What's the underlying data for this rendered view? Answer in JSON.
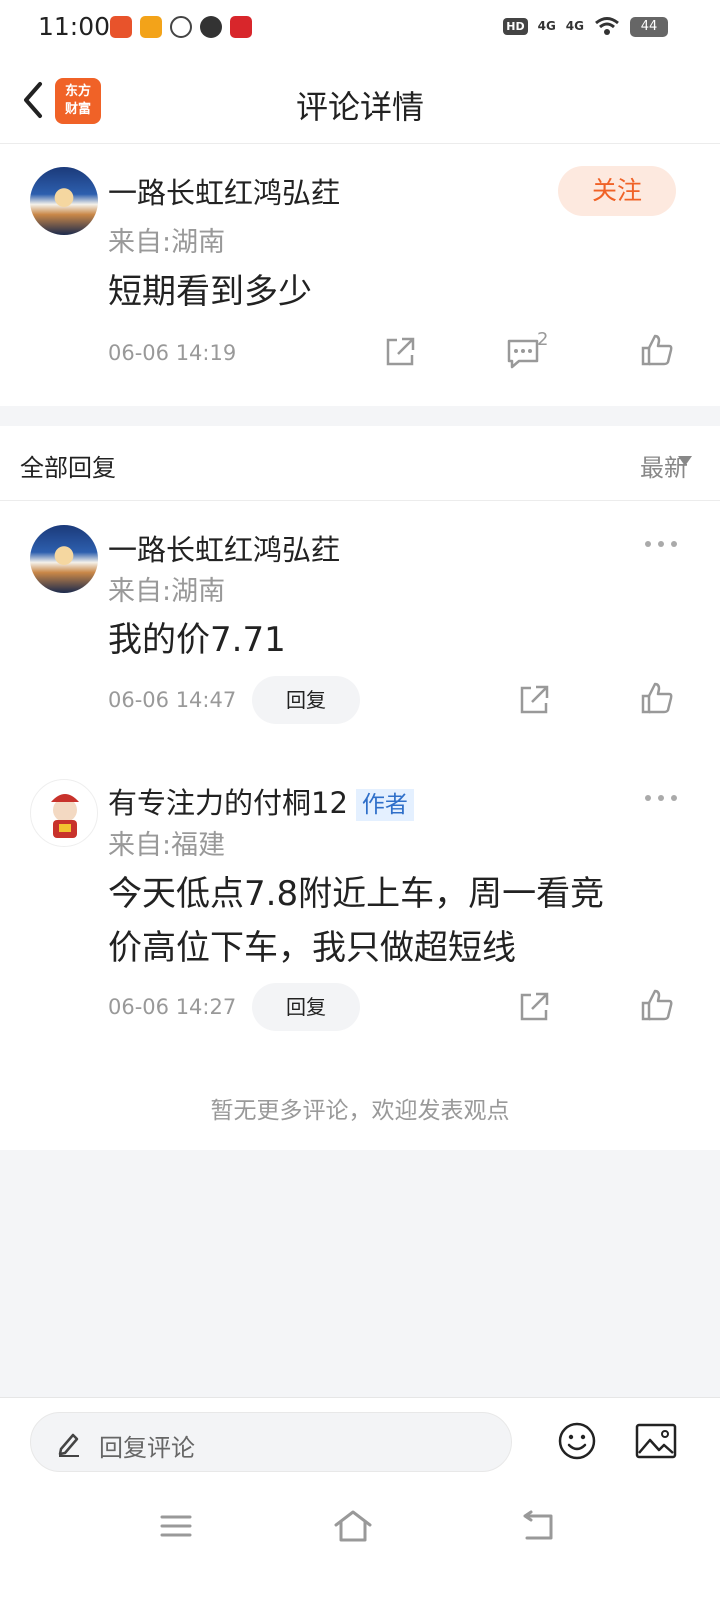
{
  "status_bar": {
    "time": "11:00",
    "network_1": "4G",
    "network_2": "4G",
    "hd_label": "HD",
    "battery": "44"
  },
  "nav": {
    "title": "评论详情",
    "logo_line1": "东方",
    "logo_line2": "财富"
  },
  "post": {
    "username": "一路长虹红鸿弘荭",
    "location": "来自:湖南",
    "text": "短期看到多少",
    "time": "06-06 14:19",
    "comment_count": "2",
    "follow_label": "关注"
  },
  "replies_header": {
    "title": "全部回复",
    "sort": "最新"
  },
  "replies": [
    {
      "username": "一路长虹红鸿弘荭",
      "location": "来自:湖南",
      "text": "我的价7.71",
      "time": "06-06 14:47",
      "reply_label": "回复"
    },
    {
      "username": "有专注力的付桐12",
      "badge": "作者",
      "location": "来自:福建",
      "text_line1": "今天低点7.8附近上车，周一看竞",
      "text_line2": "价高位下车，我只做超短线",
      "time": "06-06 14:27",
      "reply_label": "回复"
    }
  ],
  "no_more": "暂无更多评论，欢迎发表观点",
  "bottom_bar": {
    "input_placeholder": "回复评论"
  },
  "colors": {
    "accent": "#f06227",
    "accent_bg": "#fde9df",
    "badge_blue": "#2f6fc9"
  }
}
